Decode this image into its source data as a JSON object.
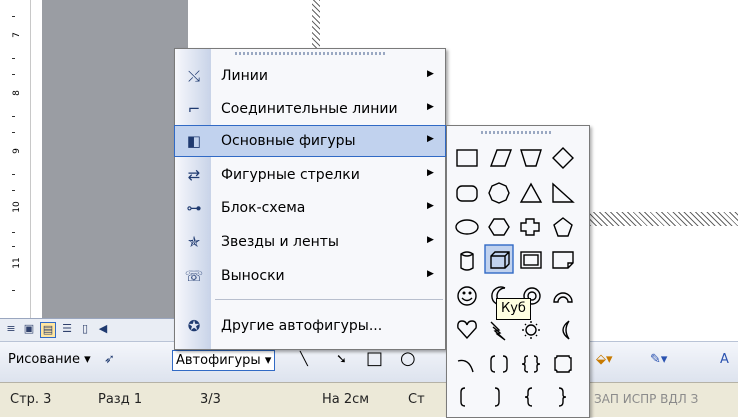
{
  "menu": {
    "items": [
      {
        "label": "Линии",
        "icon": "lines-icon"
      },
      {
        "label": "Соединительные линии",
        "icon": "connectors-icon"
      },
      {
        "label": "Основные фигуры",
        "icon": "basic-shapes-icon"
      },
      {
        "label": "Фигурные стрелки",
        "icon": "block-arrows-icon"
      },
      {
        "label": "Блок-схема",
        "icon": "flowchart-icon"
      },
      {
        "label": "Звезды и ленты",
        "icon": "stars-banners-icon"
      },
      {
        "label": "Выноски",
        "icon": "callouts-icon"
      },
      {
        "label": "Другие автофигуры...",
        "icon": "more-autoshapes-icon"
      }
    ],
    "highlighted": "Основные фигуры"
  },
  "submenu": {
    "tooltip": "Куб",
    "shapes": [
      "rectangle",
      "parallelogram",
      "trapezoid",
      "diamond",
      "rounded-rectangle",
      "octagon",
      "triangle",
      "right-triangle",
      "ellipse",
      "hexagon",
      "plus-cross",
      "pentagon",
      "can",
      "cube",
      "bevel",
      "folded-corner",
      "smiley",
      "moon-crescent",
      "donut",
      "block-arc",
      "heart",
      "lightning",
      "sun",
      "moon",
      "arc",
      "bracket-pair",
      "brace-pair",
      "plaque",
      "left-bracket",
      "right-bracket",
      "left-brace",
      "right-brace"
    ]
  },
  "toolbar": {
    "drawing_label": "Рисование",
    "autoshapes_label": "Автофигуры"
  },
  "status": {
    "page": "Стр. 3",
    "section": "Разд 1",
    "pages": "3/3",
    "position": "На 2см",
    "line": "Ст",
    "flags": "ЗАП  ИСПР  ВДЛ  З"
  },
  "ruler": {
    "labels": [
      "7",
      "8",
      "9",
      "10",
      "11"
    ]
  },
  "colors": {
    "highlight": "#c1d2ee",
    "highlight_border": "#316ac5",
    "tooltip_bg": "#ffffe1"
  }
}
